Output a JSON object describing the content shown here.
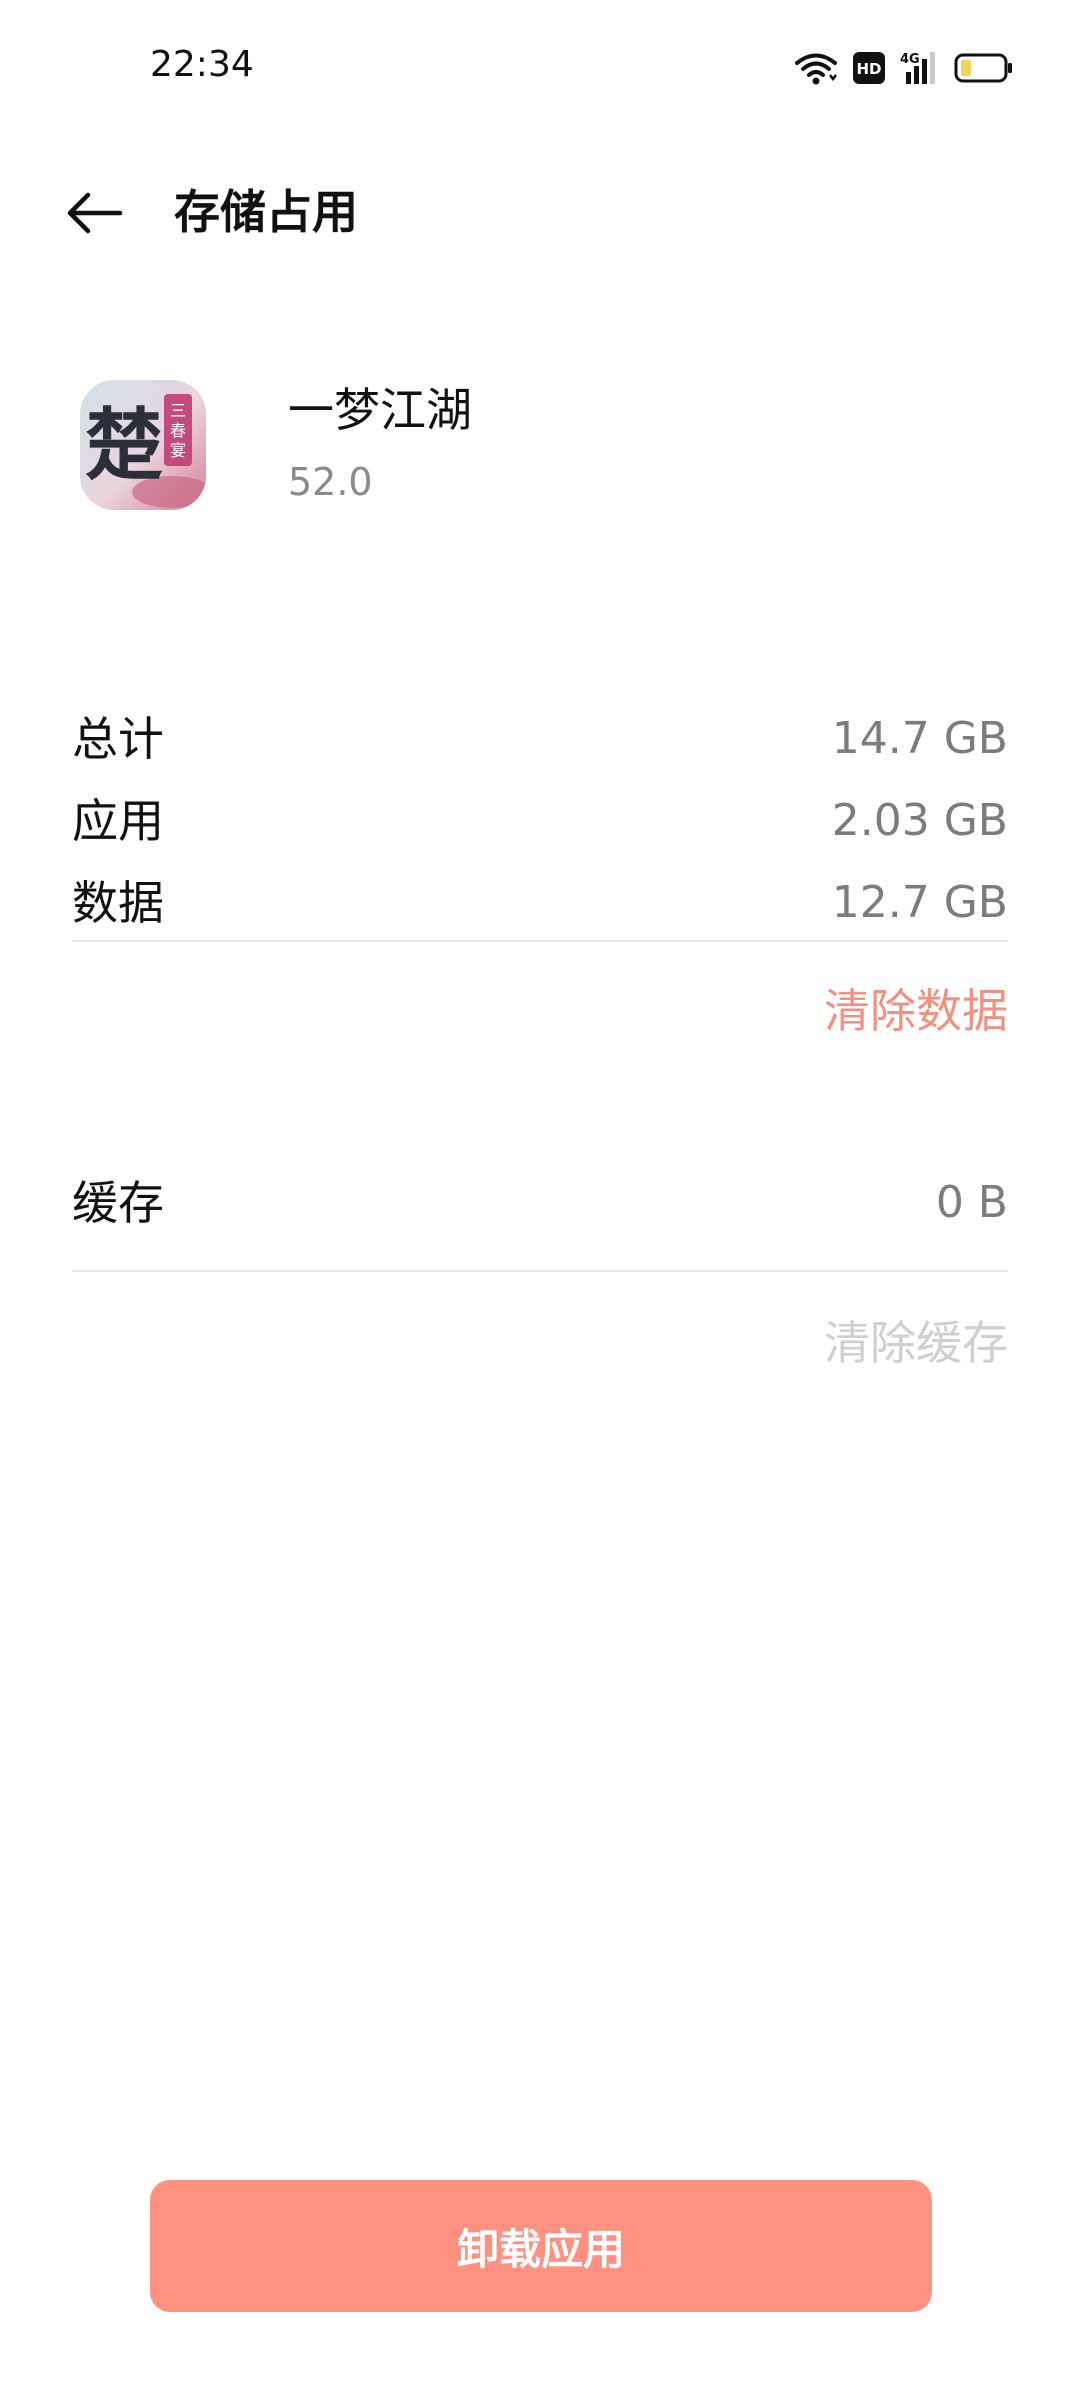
{
  "status_bar": {
    "time": "22:34",
    "icons": [
      "wifi-icon",
      "hd-icon",
      "signal-4g-icon",
      "battery-icon"
    ],
    "hd_text": "HD",
    "network_text": "4G"
  },
  "header": {
    "title": "存储占用",
    "back_icon": "arrow-left-icon"
  },
  "app": {
    "name": "一梦江湖",
    "version": "52.0",
    "icon_glyph": "楚",
    "icon_banner": "三春宴"
  },
  "storage": {
    "rows": [
      {
        "label": "总计",
        "value": "14.7 GB"
      },
      {
        "label": "应用",
        "value": "2.03 GB"
      },
      {
        "label": "数据",
        "value": "12.7 GB"
      }
    ],
    "clear_data_label": "清除数据",
    "cache": {
      "label": "缓存",
      "value": "0 B"
    },
    "clear_cache_label": "清除缓存"
  },
  "footer": {
    "uninstall_label": "卸载应用"
  },
  "colors": {
    "accent": "#ff9181",
    "link_active": "#f2917f",
    "link_disabled": "#cfcfcf",
    "value_text": "#7c7c7c"
  }
}
